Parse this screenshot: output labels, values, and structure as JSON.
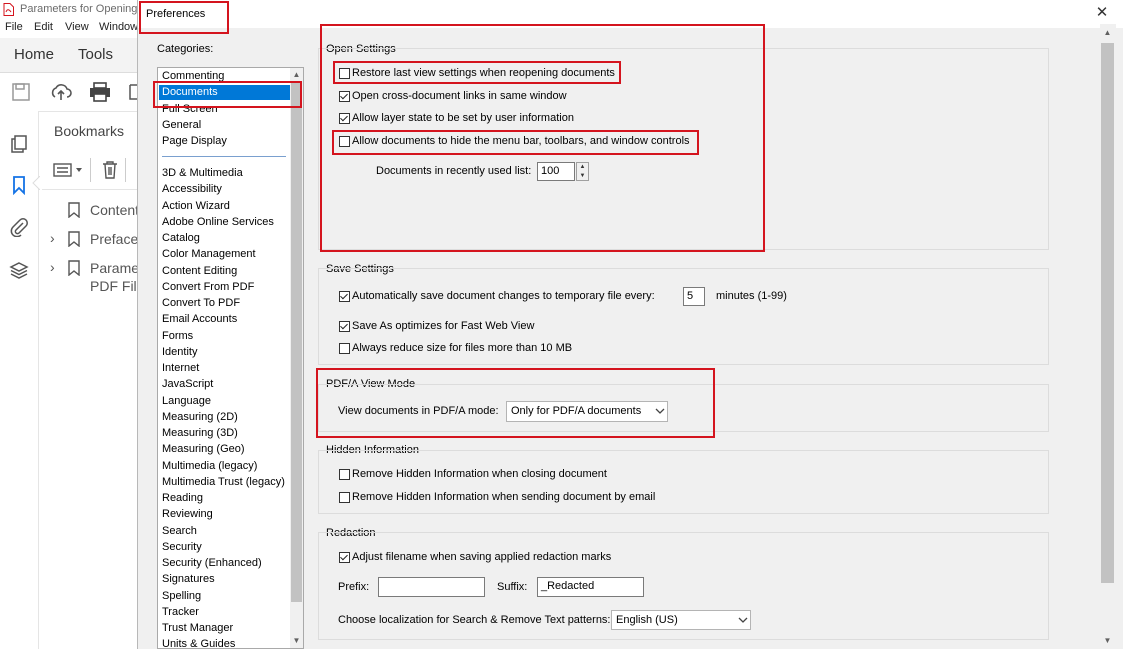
{
  "app": {
    "title": "Parameters for Opening",
    "menu": [
      "File",
      "Edit",
      "View",
      "Window"
    ],
    "tabs": [
      "Home",
      "Tools"
    ],
    "bookmarks_title": "Bookmarks",
    "bookmarks": [
      "Content",
      "Preface",
      "Paramet",
      "PDF File"
    ]
  },
  "dialog": {
    "title": "Preferences",
    "close": "✕",
    "categories_label": "Categories:",
    "categories_top": [
      "Commenting",
      "Documents",
      "Full Screen",
      "General",
      "Page Display"
    ],
    "selected": "Documents",
    "categories": [
      "3D & Multimedia",
      "Accessibility",
      "Action Wizard",
      "Adobe Online Services",
      "Catalog",
      "Color Management",
      "Content Editing",
      "Convert From PDF",
      "Convert To PDF",
      "Email Accounts",
      "Forms",
      "Identity",
      "Internet",
      "JavaScript",
      "Language",
      "Measuring (2D)",
      "Measuring (3D)",
      "Measuring (Geo)",
      "Multimedia (legacy)",
      "Multimedia Trust (legacy)",
      "Reading",
      "Reviewing",
      "Search",
      "Security",
      "Security (Enhanced)",
      "Signatures",
      "Spelling",
      "Tracker",
      "Trust Manager",
      "Units & Guides"
    ]
  },
  "open_settings": {
    "title": "Open Settings",
    "restore": "Restore last view settings when reopening documents",
    "cross_doc": "Open cross-document links in same window",
    "layer_state": "Allow layer state to be set by user information",
    "hide_menu": "Allow documents to hide the menu bar, toolbars, and window controls",
    "recent_label": "Documents in recently used list:",
    "recent_value": "100",
    "restore_checked": false,
    "cross_doc_checked": true,
    "layer_state_checked": true,
    "hide_menu_checked": false
  },
  "save_settings": {
    "title": "Save Settings",
    "autosave": "Automatically save document changes to temporary file every:",
    "autosave_value": "5",
    "autosave_unit": "minutes (1-99)",
    "fast_web": "Save As optimizes for Fast Web View",
    "reduce_size": "Always reduce size for files more than 10 MB",
    "autosave_checked": true,
    "fast_web_checked": true,
    "reduce_size_checked": false
  },
  "pdfa": {
    "title": "PDF/A View Mode",
    "label": "View documents in PDF/A mode:",
    "value": "Only for PDF/A documents"
  },
  "hidden_info": {
    "title": "Hidden Information",
    "closing": "Remove Hidden Information when closing document",
    "sending": "Remove Hidden Information when sending document by email",
    "closing_checked": false,
    "sending_checked": false
  },
  "redaction": {
    "title": "Redaction",
    "adjust": "Adjust filename when saving applied redaction marks",
    "adjust_checked": true,
    "prefix_label": "Prefix:",
    "prefix_value": "",
    "suffix_label": "Suffix:",
    "suffix_value": "_Redacted",
    "locale_label": "Choose localization for Search & Remove Text patterns:",
    "locale_value": "English (US)"
  },
  "colors": {
    "highlight": "#d4141e",
    "selection": "#0078d7"
  }
}
